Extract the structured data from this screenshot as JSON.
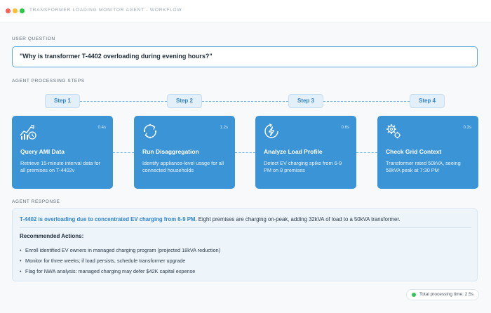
{
  "window": {
    "title": "TRANSFORMER LOADING MONITOR AGENT - WORKFLOW"
  },
  "question": {
    "section_label": "USER QUESTION",
    "text": "\"Why is transformer T-4402 overloading during evening hours?\""
  },
  "steps_section_label": "AGENT PROCESSING STEPS",
  "steps": [
    {
      "pill": "Step 1",
      "time": "0.4s",
      "icon": "chart-clock-icon",
      "title": "Query AMI Data",
      "description": "Retrieve 15-minute interval data for all premises on T-4402v"
    },
    {
      "pill": "Step 2",
      "time": "1.2s",
      "icon": "cycle-arrows-icon",
      "title": "Run Disaggregation",
      "description": "Identify appliance-level usage for all connected households"
    },
    {
      "pill": "Step 3",
      "time": "0.6s",
      "icon": "lightning-icon",
      "title": "Analyze Load Profile",
      "description": "Detect EV charging spike from 6-9 PM on 8 premises"
    },
    {
      "pill": "Step 4",
      "time": "0.3s",
      "icon": "gears-icon",
      "title": "Check Grid Context",
      "description": "Transformer rated 50kVA, seeing 58kVA peak at 7:30 PM"
    }
  ],
  "response": {
    "section_label": "AGENT RESPONSE",
    "highlight": "T-4402 is overloading due to concentrated EV charging from 6-9 PM.",
    "rest": " Eight premises are charging on-peak, adding 32kVA of load to a 50kVA transformer.",
    "recommendations_title": "Recommended Actions:",
    "recommendations": [
      "Enroll identified EV owners in managed charging program (projected 18kVA reduction)",
      "Monitor for three weeks; if load persists, schedule transformer upgrade",
      "Flag for NWA analysis: managed charging may defer $42K capital expense"
    ]
  },
  "status": {
    "text": "Total processing time: 2.5s",
    "color": "#33c45a"
  },
  "colors": {
    "accent": "#3b94d6",
    "pill_bg": "#e3eff9",
    "highlight_text": "#2f84c9"
  }
}
